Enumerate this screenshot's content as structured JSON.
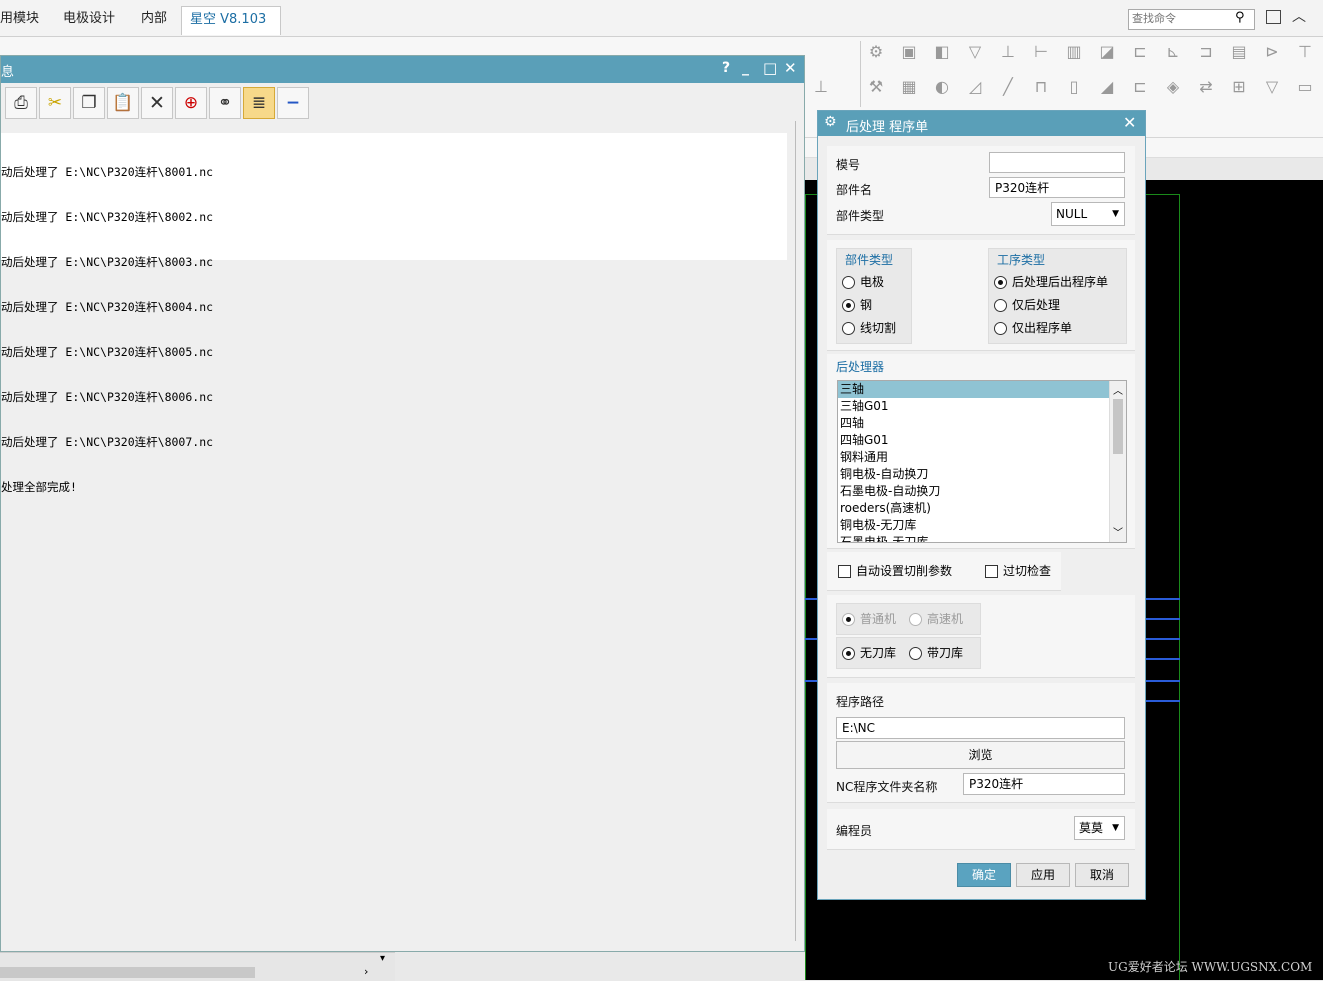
{
  "ribbon": {
    "tabs": [
      "用模块",
      "电极设计",
      "内部",
      "星空 V8.103"
    ],
    "active_tab": 3,
    "search_placeholder": "查找命令"
  },
  "info_window": {
    "title": "息",
    "title_buttons": [
      "?",
      "_",
      "□",
      "✕"
    ],
    "toolbar": [
      "print-icon",
      "scissors-icon",
      "copy-icon",
      "paste-icon",
      "delete-icon",
      "target-icon",
      "binoculars-icon",
      "wrap-text-icon",
      "minus-icon"
    ],
    "lines": [
      "动后处理了 E:\\NC\\P320连杆\\8001.nc",
      "动后处理了 E:\\NC\\P320连杆\\8002.nc",
      "动后处理了 E:\\NC\\P320连杆\\8003.nc",
      "动后处理了 E:\\NC\\P320连杆\\8004.nc",
      "动后处理了 E:\\NC\\P320连杆\\8005.nc",
      "动后处理了 E:\\NC\\P320连杆\\8006.nc",
      "动后处理了 E:\\NC\\P320连杆\\8007.nc",
      "处理全部完成!"
    ]
  },
  "dialog": {
    "title": "后处理 程序单",
    "mold_no_label": "模号",
    "mold_no_value": "",
    "part_name_label": "部件名",
    "part_name_value": "P320连杆",
    "part_type_label": "部件类型",
    "part_type_value": "NULL",
    "part_type_group": {
      "title": "部件类型",
      "options": [
        "电极",
        "钢",
        "线切割"
      ],
      "selected": "钢"
    },
    "process_group": {
      "title": "工序类型",
      "options": [
        "后处理后出程序单",
        "仅后处理",
        "仅出程序单"
      ],
      "selected": "后处理后出程序单"
    },
    "postprocessor_label": "后处理器",
    "postprocessors": [
      "三轴",
      "三轴G01",
      "四轴",
      "四轴G01",
      "钢料通用",
      "铜电极-自动换刀",
      "石墨电极-自动换刀",
      "roeders(高速机)",
      "铜电极-无刀库",
      "石墨电极-无刀库"
    ],
    "selected_postprocessor": "三轴",
    "auto_params_label": "自动设置切削参数",
    "gouge_check_label": "过切检查",
    "machine_options": [
      "普通机",
      "高速机"
    ],
    "machine_selected": "普通机",
    "magazine_options": [
      "无刀库",
      "带刀库"
    ],
    "magazine_selected": "无刀库",
    "program_path_label": "程序路径",
    "program_path_value": "E:\\NC",
    "browse_label": "浏览",
    "nc_folder_label": "NC程序文件夹名称",
    "nc_folder_value": "P320连杆",
    "programmer_label": "编程员",
    "programmer_value": "莫莫",
    "ok_label": "确定",
    "apply_label": "应用",
    "cancel_label": "取消"
  },
  "watermark": "UG爱好者论坛 WWW.UGSNX.COM",
  "colors": {
    "title_bar": "#5a9fb8",
    "list_selection": "#8fc3d3",
    "accent_text": "#1c6ea4",
    "graphics_bg": "#000000"
  }
}
